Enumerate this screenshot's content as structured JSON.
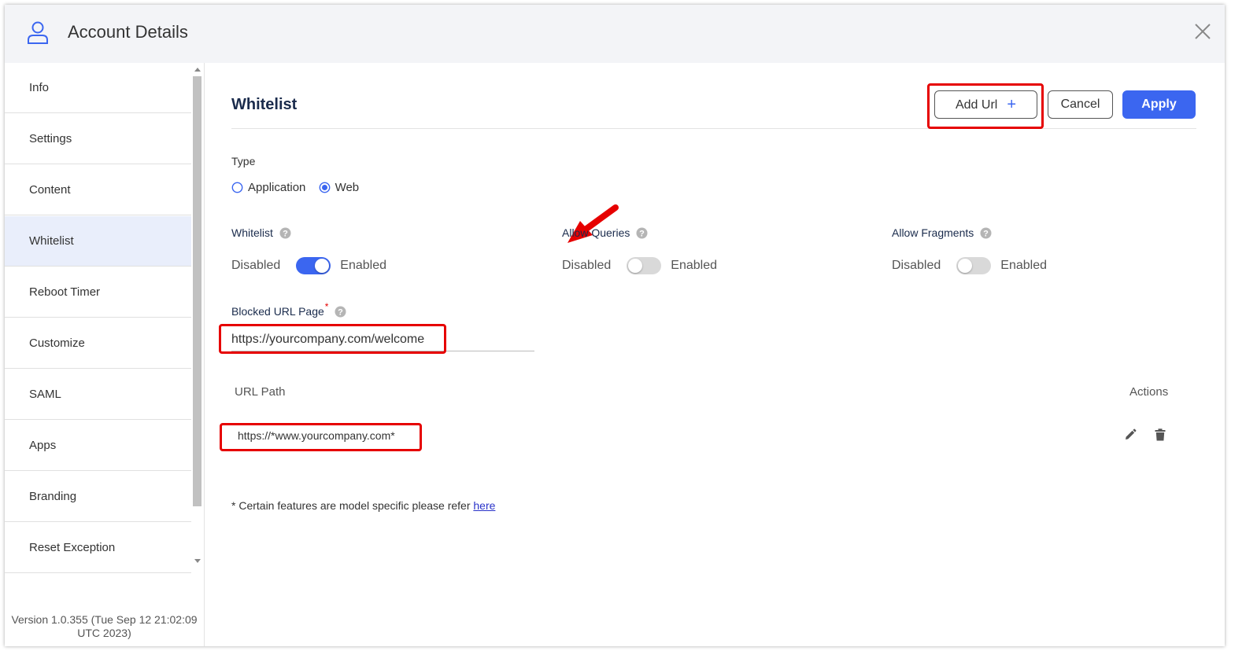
{
  "header": {
    "title": "Account Details",
    "icon": "user-icon"
  },
  "sidebar": {
    "items": [
      {
        "label": "Info"
      },
      {
        "label": "Settings"
      },
      {
        "label": "Content"
      },
      {
        "label": "Whitelist",
        "active": true
      },
      {
        "label": "Reboot Timer"
      },
      {
        "label": "Customize"
      },
      {
        "label": "SAML"
      },
      {
        "label": "Apps"
      },
      {
        "label": "Branding"
      },
      {
        "label": "Reset Exception"
      }
    ],
    "version_line1": "Version 1.0.355 (Tue Sep 12 21:02:09",
    "version_line2": "UTC 2023)"
  },
  "main": {
    "title": "Whitelist",
    "buttons": {
      "add_url": "Add Url",
      "cancel": "Cancel",
      "apply": "Apply"
    },
    "type": {
      "label": "Type",
      "options": [
        "Application",
        "Web"
      ],
      "selected": "Web"
    },
    "toggles": [
      {
        "title": "Whitelist",
        "off_label": "Disabled",
        "on_label": "Enabled",
        "enabled": true
      },
      {
        "title": "Allow Queries",
        "off_label": "Disabled",
        "on_label": "Enabled",
        "enabled": false
      },
      {
        "title": "Allow Fragments",
        "off_label": "Disabled",
        "on_label": "Enabled",
        "enabled": false
      }
    ],
    "blocked_url": {
      "label": "Blocked URL Page",
      "required_mark": "*",
      "value": "https://yourcompany.com/welcome"
    },
    "table": {
      "col_path": "URL Path",
      "col_actions": "Actions",
      "rows": [
        {
          "path": "https://*www.yourcompany.com*"
        }
      ]
    },
    "footnote": {
      "text": "* Certain features are model specific please refer ",
      "link": "here"
    }
  },
  "colors": {
    "accent": "#3b66f0",
    "highlight": "#e60000",
    "header_bg": "#f3f4f7",
    "active_item_bg": "#e9eefb"
  }
}
